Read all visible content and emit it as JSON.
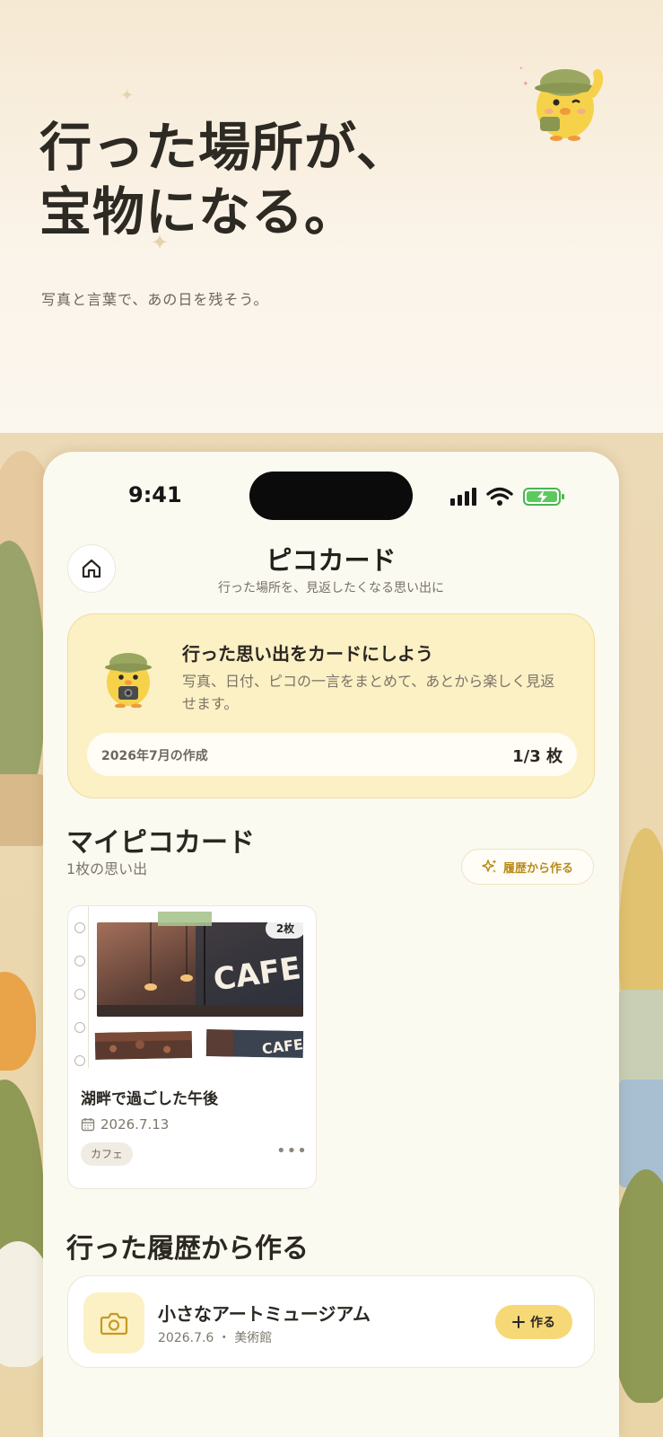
{
  "hero": {
    "title_line1": "行った場所が、",
    "title_line2": "宝物になる。",
    "subtitle": "写真と言葉で、あの日を残そう。"
  },
  "status_bar": {
    "time": "9:41",
    "icons": [
      "signal-icon",
      "wifi-icon",
      "battery-charging-icon"
    ]
  },
  "header": {
    "home_icon": "home-icon",
    "title": "ピコカード",
    "subtitle": "行った場所を、見返したくなる思い出に"
  },
  "intro_card": {
    "title": "行った思い出をカードにしよう",
    "body": "写真、日付、ピコの一言をまとめて、あとから楽しく見返せます。",
    "usage_label": "2026年7月の作成",
    "usage_count": "1/3 枚"
  },
  "my_cards": {
    "title": "マイピコカード",
    "subtitle": "1枚の思い出",
    "create_from_history_label": "履歴から作る",
    "cards": [
      {
        "title": "湖畔で過ごした午後",
        "date": "2026.7.13",
        "tag": "カフェ",
        "photo_count": "2枚",
        "photo_sign": "CAFE"
      }
    ]
  },
  "history": {
    "title": "行った履歴から作る",
    "items": [
      {
        "name": "小さなアートミュージアム",
        "meta": "2026.7.6 ・ 美術館",
        "action_label": "作る"
      }
    ]
  },
  "colors": {
    "accent_yellow": "#f6d877",
    "card_yellow": "#fcf0c5",
    "gold_text": "#b98a18",
    "background": "#fbfaf0"
  }
}
